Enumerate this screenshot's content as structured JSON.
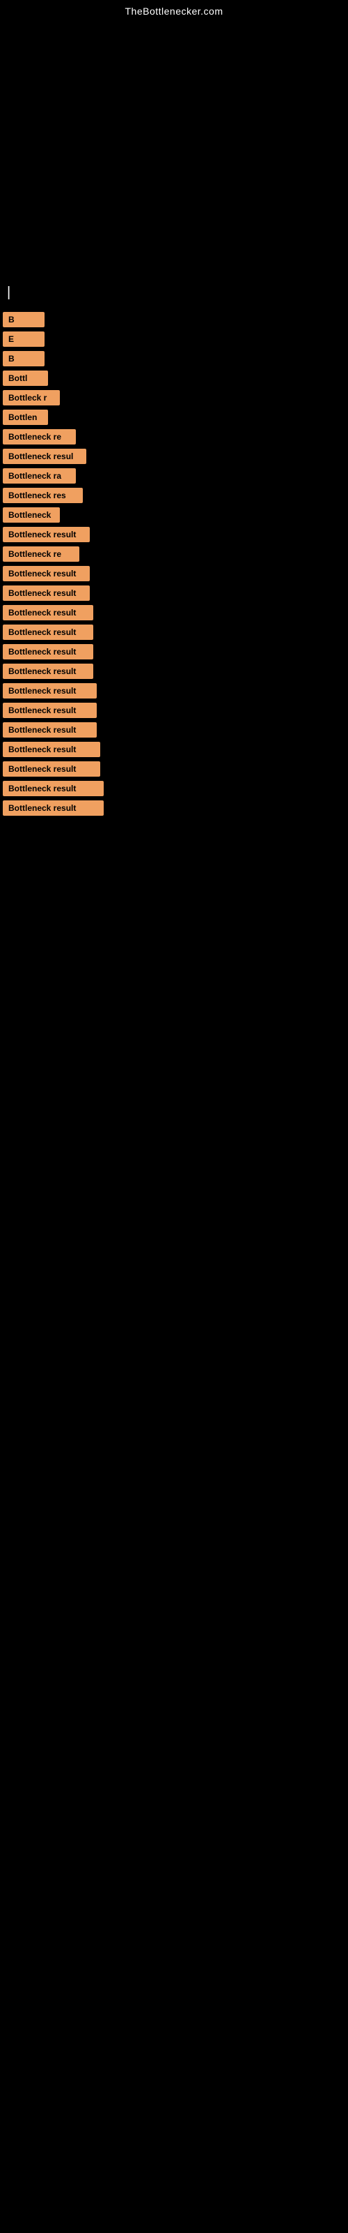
{
  "site": {
    "title": "TheBottlenecker.com"
  },
  "items": [
    {
      "id": 1,
      "label": "B",
      "width_class": "w-20"
    },
    {
      "id": 2,
      "label": "E",
      "width_class": "w-22"
    },
    {
      "id": 3,
      "label": "B",
      "width_class": "w-22"
    },
    {
      "id": 4,
      "label": "Bottl",
      "width_class": "w-60"
    },
    {
      "id": 5,
      "label": "Bottleck r",
      "width_class": "w-80"
    },
    {
      "id": 6,
      "label": "Bottlen",
      "width_class": "w-60"
    },
    {
      "id": 7,
      "label": "Bottleneck re",
      "width_class": "w-100"
    },
    {
      "id": 8,
      "label": "Bottleneck resul",
      "width_class": "w-115"
    },
    {
      "id": 9,
      "label": "Bottleneck ra",
      "width_class": "w-100"
    },
    {
      "id": 10,
      "label": "Bottleneck res",
      "width_class": "w-110"
    },
    {
      "id": 11,
      "label": "Bottleneck",
      "width_class": "w-80"
    },
    {
      "id": 12,
      "label": "Bottleneck result",
      "width_class": "w-120"
    },
    {
      "id": 13,
      "label": "Bottleneck re",
      "width_class": "w-105"
    },
    {
      "id": 14,
      "label": "Bottleneck result",
      "width_class": "w-120"
    },
    {
      "id": 15,
      "label": "Bottleneck result",
      "width_class": "w-120"
    },
    {
      "id": 16,
      "label": "Bottleneck result",
      "width_class": "w-125"
    },
    {
      "id": 17,
      "label": "Bottleneck result",
      "width_class": "w-125"
    },
    {
      "id": 18,
      "label": "Bottleneck result",
      "width_class": "w-125"
    },
    {
      "id": 19,
      "label": "Bottleneck result",
      "width_class": "w-125"
    },
    {
      "id": 20,
      "label": "Bottleneck result",
      "width_class": "w-130"
    },
    {
      "id": 21,
      "label": "Bottleneck result",
      "width_class": "w-130"
    },
    {
      "id": 22,
      "label": "Bottleneck result",
      "width_class": "w-130"
    },
    {
      "id": 23,
      "label": "Bottleneck result",
      "width_class": "w-135"
    },
    {
      "id": 24,
      "label": "Bottleneck result",
      "width_class": "w-135"
    },
    {
      "id": 25,
      "label": "Bottleneck result",
      "width_class": "w-140"
    },
    {
      "id": 26,
      "label": "Bottleneck result",
      "width_class": "w-140"
    }
  ]
}
